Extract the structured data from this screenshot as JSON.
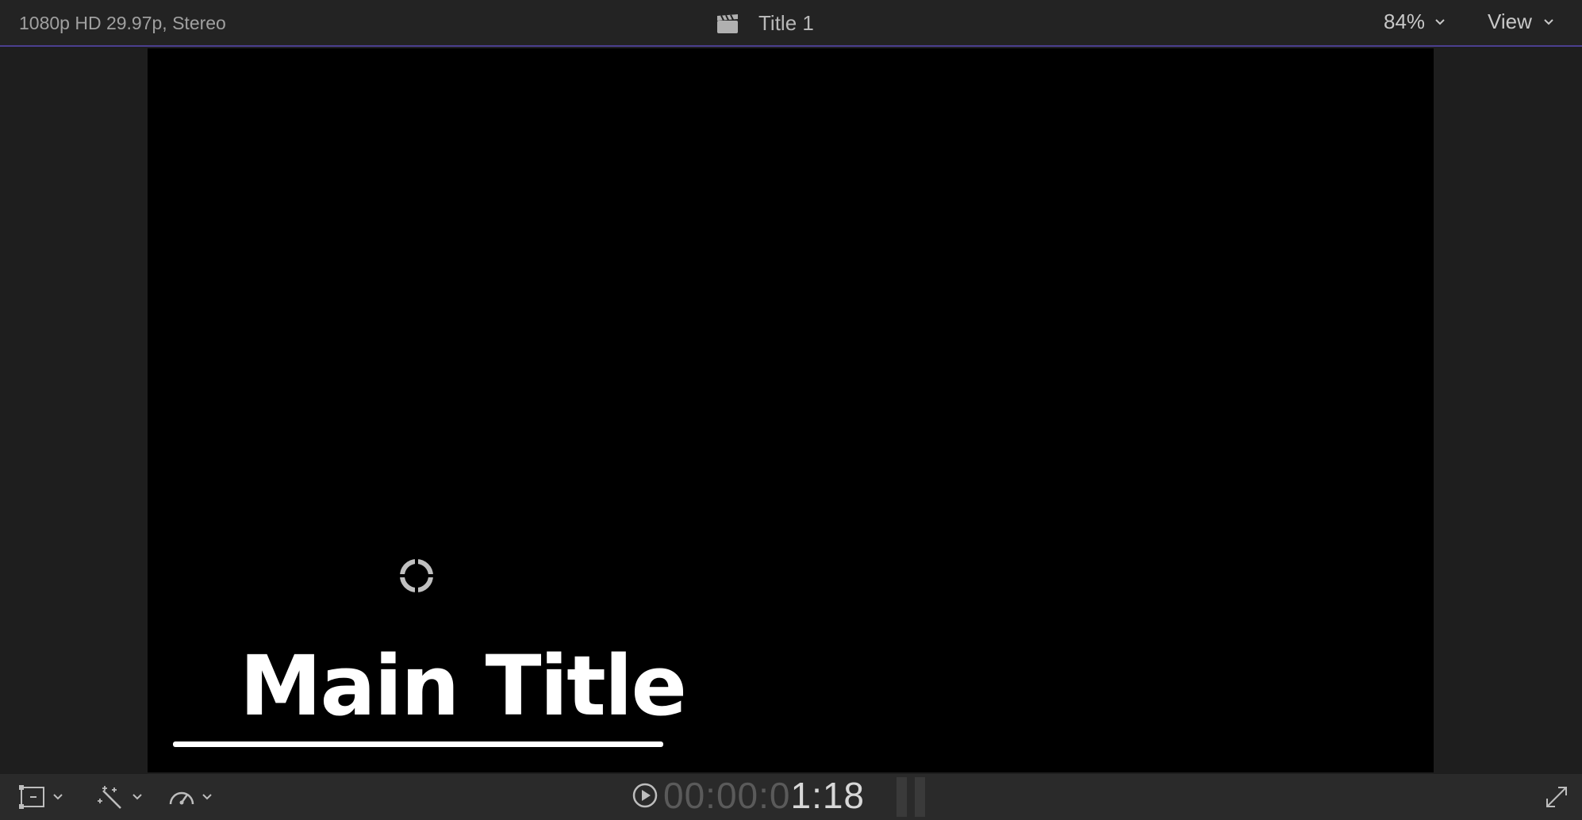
{
  "topbar": {
    "format_info": "1080p HD 29.97p, Stereo",
    "clip_title": "Title 1",
    "zoom_label": "84%",
    "view_label": "View"
  },
  "canvas": {
    "main_title_text": "Main Title"
  },
  "bottombar": {
    "timecode_dim": "00:00:0",
    "timecode_lit": "1:18",
    "tools": [
      {
        "icon": "transform-icon"
      },
      {
        "icon": "enhance-wand-icon"
      },
      {
        "icon": "retime-speedometer-icon"
      }
    ]
  },
  "colors": {
    "accent_line": "#4b3f8f",
    "background": "#1e1e1e",
    "canvas": "#000000"
  }
}
